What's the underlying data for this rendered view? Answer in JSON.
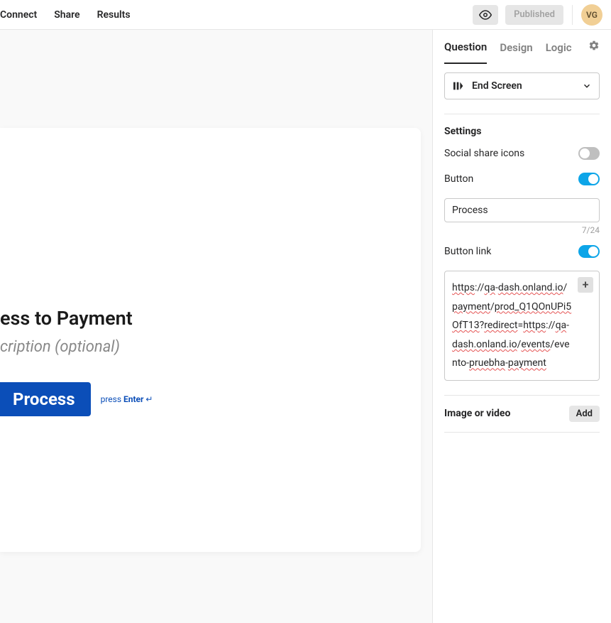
{
  "topnav": {
    "items": [
      "Connect",
      "Share",
      "Results"
    ],
    "published_label": "Published",
    "avatar_initials": "VG"
  },
  "canvas": {
    "title_fragment": "ess to Payment",
    "description_fragment": "cription (optional)",
    "button_label": "Process",
    "hint_prefix": "press ",
    "hint_key": "Enter",
    "hint_symbol": " ↵"
  },
  "panel": {
    "tabs": {
      "question": "Question",
      "design": "Design",
      "logic": "Logic"
    },
    "dropdown_label": "End Screen",
    "settings_title": "Settings",
    "social_label": "Social share icons",
    "button_label": "Button",
    "button_text_value": "Process",
    "char_count": "7/24",
    "button_link_label": "Button link",
    "link_parts": {
      "p1": "https",
      "p2": "://",
      "p3": "qa",
      "p4": "-",
      "p5": "dash.onland.io",
      "p6": "/",
      "p7": "payment",
      "p8": "/",
      "p9": "prod_Q1QOnUPi5OfT13",
      "p10": "?",
      "p11": "redirect",
      "p12": "=",
      "p13": "https",
      "p14": "://",
      "p15": "qa",
      "p16": "-",
      "p17": "dash.onland.io",
      "p18": "/",
      "p19": "events",
      "p20": "/eve",
      "p21": "nto-",
      "p22": "pruebha",
      "p23": "-",
      "p24": "payment"
    },
    "media_label": "Image or video",
    "add_label": "Add"
  }
}
